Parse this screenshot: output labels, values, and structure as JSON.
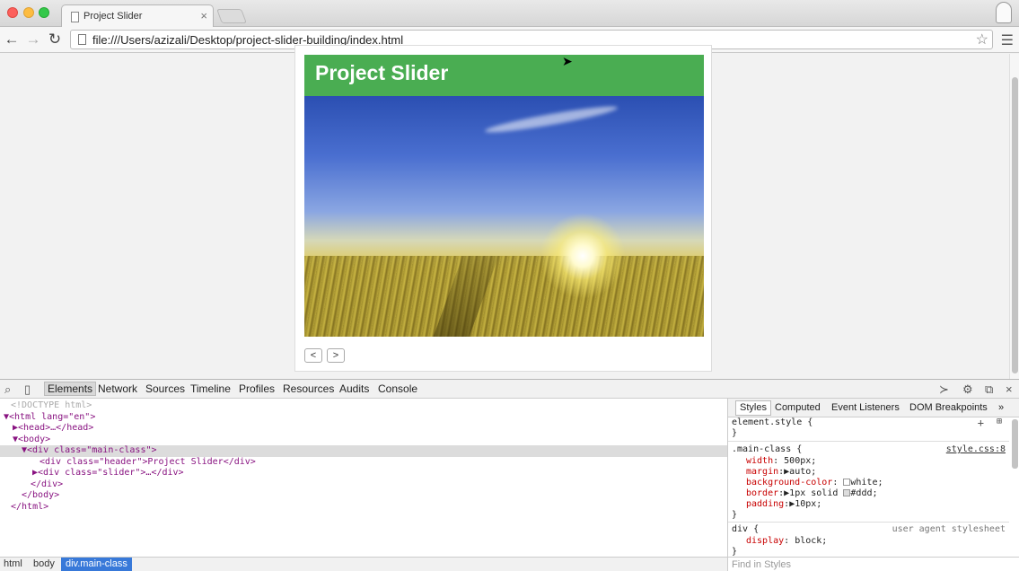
{
  "window": {
    "tab_title": "Project Slider",
    "tab_close": "×"
  },
  "toolbar": {
    "url": "file:///Users/azizali/Desktop/project-slider-building/index.html",
    "back": "←",
    "forward": "→",
    "reload": "↻",
    "star": "☆",
    "menu": "☰"
  },
  "page": {
    "header_title": "Project Slider",
    "prev_label": "<",
    "next_label": ">"
  },
  "devtools": {
    "tabs": [
      "Elements",
      "Network",
      "Sources",
      "Timeline",
      "Profiles",
      "Resources",
      "Audits",
      "Console"
    ],
    "active_tab": "Elements",
    "dom_lines": [
      {
        "text": "<!DOCTYPE html>"
      },
      {
        "text": "▼<html lang=\"en\">"
      },
      {
        "text": "▶<head>…</head>"
      },
      {
        "text": "▼<body>"
      },
      {
        "text": "▼<div class=\"main-class\">"
      },
      {
        "text": "<div class=\"header\">Project Slider</div>"
      },
      {
        "text": "▶<div class=\"slider\">…</div>"
      },
      {
        "text": "</div>"
      },
      {
        "text": "</body>"
      },
      {
        "text": "</html>"
      }
    ],
    "breadcrumbs": [
      "html",
      "body",
      "div.main-class"
    ],
    "styles_tabs": [
      "Styles",
      "Computed",
      "Event Listeners",
      "DOM Breakpoints"
    ],
    "styles_more": "»",
    "rules": {
      "element_style": "element.style {",
      "close": "}",
      "main_selector": ".main-class {",
      "main_source": "style.css:8",
      "main_props": [
        {
          "name": "width",
          "value": "500px;"
        },
        {
          "name": "margin",
          "value": "▶auto;"
        },
        {
          "name": "background-color",
          "value": "white;"
        },
        {
          "name": "border",
          "value": "▶1px solid",
          "value2": "#ddd;"
        },
        {
          "name": "padding",
          "value": "▶10px;"
        }
      ],
      "div_selector": "div {",
      "div_source": "user agent stylesheet",
      "div_props": [
        {
          "name": "display",
          "value": "block;"
        }
      ]
    },
    "find_placeholder": "Find in Styles"
  },
  "colors": {
    "header_green": "#4aad52",
    "devtools_select": "#3879d9"
  }
}
